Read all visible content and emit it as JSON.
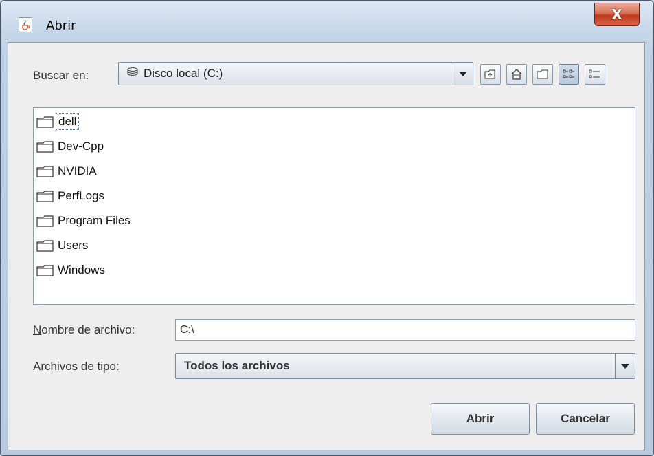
{
  "window": {
    "title": "Abrir",
    "close_label": "X"
  },
  "look_in": {
    "label": "Buscar en:",
    "value": "Disco local (C:)"
  },
  "toolbar": {
    "icons": [
      "up-one-level-icon",
      "home-icon",
      "new-folder-icon",
      "list-view-icon",
      "details-view-icon"
    ]
  },
  "files": [
    {
      "name": "dell"
    },
    {
      "name": "Dev-Cpp"
    },
    {
      "name": "NVIDIA"
    },
    {
      "name": "PerfLogs"
    },
    {
      "name": "Program Files"
    },
    {
      "name": "Users"
    },
    {
      "name": "Windows"
    }
  ],
  "filename": {
    "label_first": "N",
    "label_rest": "ombre de archivo:",
    "value": "C:\\"
  },
  "filetype": {
    "label_pre": "Archivos de ",
    "label_u": "t",
    "label_post": "ipo:",
    "value": "Todos los archivos"
  },
  "buttons": {
    "open": "Abrir",
    "cancel": "Cancelar"
  },
  "colors": {
    "close": "#c0391b",
    "client_bg": "#eeeeee",
    "list_bg": "#ffffff"
  }
}
